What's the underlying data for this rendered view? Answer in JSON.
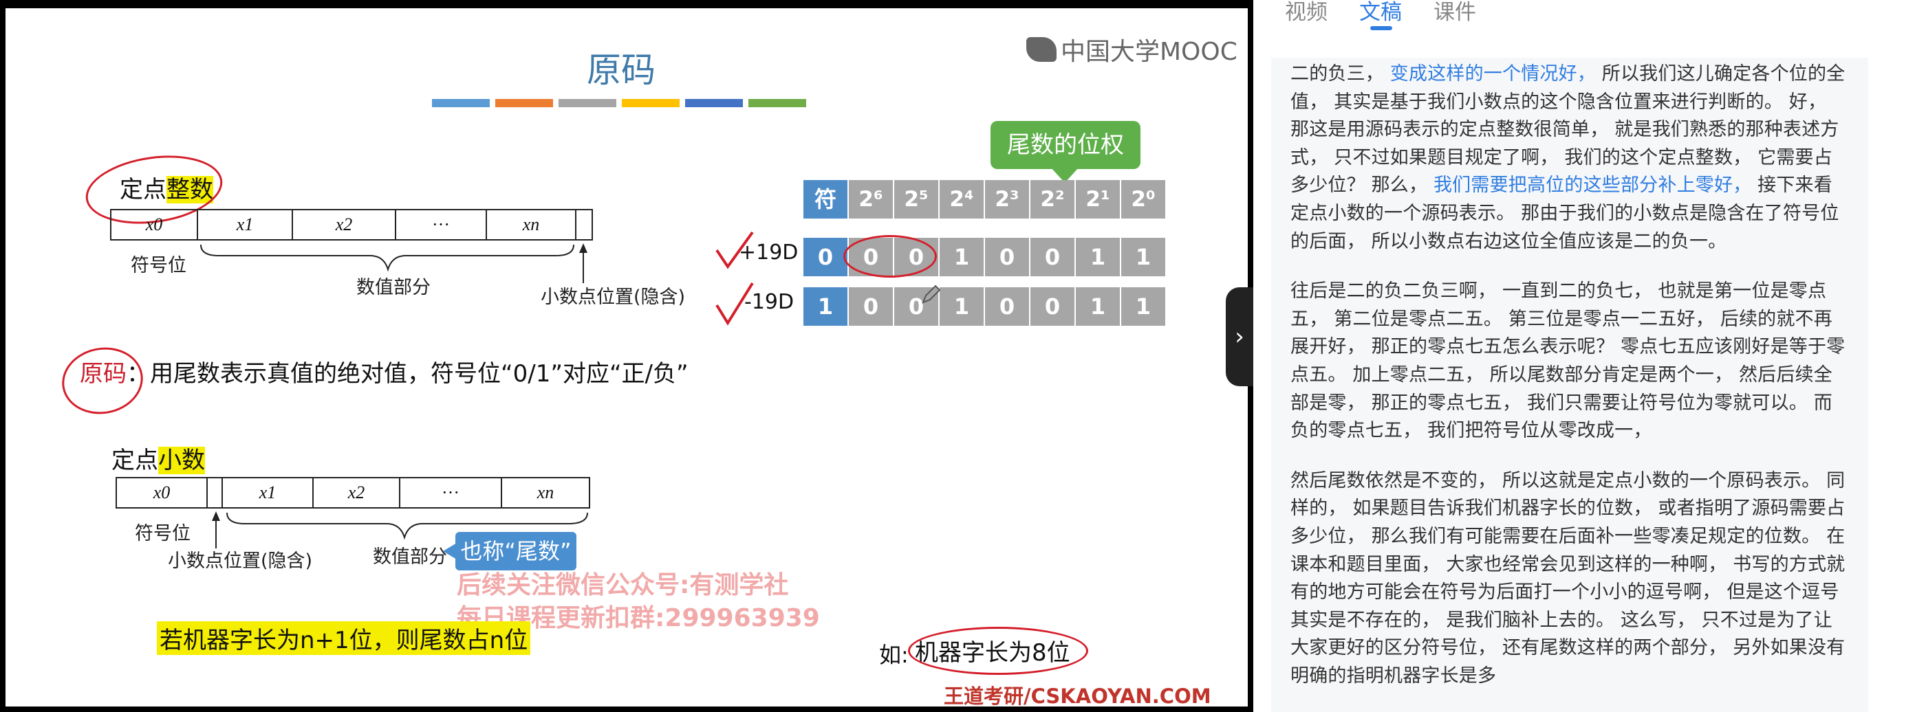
{
  "tabs": [
    "视频",
    "文稿",
    "课件"
  ],
  "slide": {
    "title": "原码",
    "logo": "中国大学MOOC",
    "color_bars": [
      "#5b9bd5",
      "#ed7d31",
      "#a5a5a5",
      "#ffc000",
      "#4472c4",
      "#70ad47"
    ],
    "integer_label_prefix": "定点",
    "integer_label_hl": "整数",
    "int_cells": [
      "x0",
      "x1",
      "x2",
      "···",
      "xn"
    ],
    "int_sign_label": "符号位",
    "int_value_label": "数值部分",
    "int_point_label": "小数点位置(隐含)",
    "mantissa_callout": "尾数的位权",
    "table_header": [
      "符",
      "2⁶",
      "2⁵",
      "2⁴",
      "2³",
      "2²",
      "2¹",
      "2⁰"
    ],
    "rows": [
      {
        "label": "+19D",
        "bits": [
          "0",
          "0",
          "0",
          "1",
          "0",
          "0",
          "1",
          "1"
        ]
      },
      {
        "label": "-19D",
        "bits": [
          "1",
          "0",
          "0",
          "1",
          "0",
          "0",
          "1",
          "1"
        ]
      }
    ],
    "yuanma_word": "原码",
    "yuanma_def": "：用尾数表示真值的绝对值，符号位“0/1”对应“正/负”",
    "fraction_label_prefix": "定点",
    "fraction_label_hl": "小数",
    "frac_cells": [
      "x0",
      "x1",
      "x2",
      "···",
      "xn"
    ],
    "frac_sign_label": "符号位",
    "frac_point_label": "小数点位置(隐含)",
    "frac_value_label": "数值部分",
    "also_called": "也称“尾数”",
    "watermark_1": "后续关注微信公众号:有测学社",
    "watermark_2": "每日课程更新扣群:299963939",
    "machine_note": "若机器字长为n+1位，则尾数占n位",
    "example_prefix": "如:",
    "example_box": "机器字长为8位",
    "brand": "王道考研/CSKAOYAN.COM"
  },
  "transcript": {
    "p1": [
      {
        "t": "二的负三， "
      },
      {
        "t": "变成这样的一个情况好，",
        "link": true
      },
      {
        "t": " 所以我们这儿确定各个位的全值， 其实是基于我们小数点的这个隐含位置来进行判断的。 好， 那这是用源码表示的定点整数很简单， 就是我们熟悉的那种表述方式， 只不过如果题目规定了啊， 我们的这个定点整数， 它需要占多少位？ 那么， "
      },
      {
        "t": "我们需要把高位的这些部分补上零好，",
        "link": true
      },
      {
        "t": " 接下来看定点小数的一个源码表示。 那由于我们的小数点是隐含在了符号位的后面， 所以小数点右边这位全值应该是二的负一。"
      }
    ],
    "p2": "往后是二的负二负三啊， 一直到二的负七， 也就是第一位是零点五， 第二位是零点二五。 第三位是零点一二五好， 后续的就不再展开好， 那正的零点七五怎么表示呢？ 零点七五应该刚好是等于零点五。 加上零点二五， 所以尾数部分肯定是两个一， 然后后续全部是零， 那正的零点七五， 我们只需要让符号位为零就可以。 而负的零点七五， 我们把符号位从零改成一，",
    "p3": "然后尾数依然是不变的， 所以这就是定点小数的一个原码表示。 同样的， 如果题目告诉我们机器字长的位数， 或者指明了源码需要占多少位， 那么我们有可能需要在后面补一些零凑足规定的位数。 在课本和题目里面， 大家也经常会见到这样的一种啊， 书写的方式就有的地方可能会在符号为后面打一个小小的逗号啊， 但是这个逗号其实是不存在的， 是我们脑补上去的。 这么写， 只不过是为了让大家更好的区分符号位， 还有尾数这样的两个部分， 另外如果没有明确的指明机器字长是多"
  }
}
